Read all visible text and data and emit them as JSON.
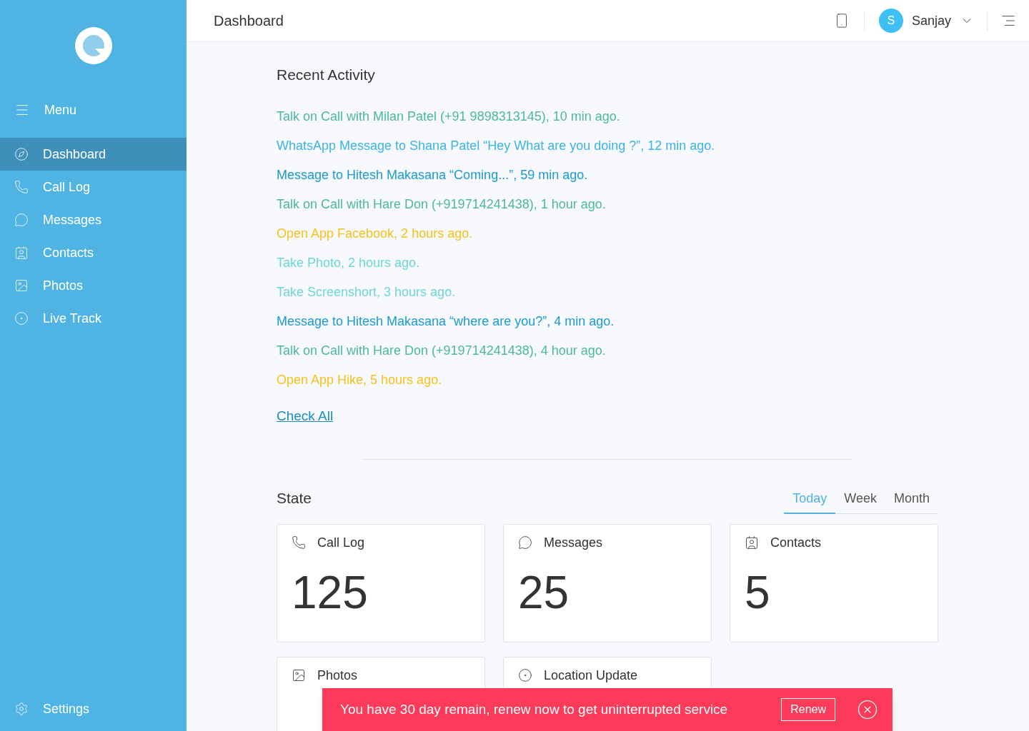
{
  "sidebar": {
    "menu_label": "Menu",
    "items": [
      {
        "label": "Dashboard",
        "selected": true
      },
      {
        "label": "Call Log",
        "selected": false
      },
      {
        "label": "Messages",
        "selected": false
      },
      {
        "label": "Contacts",
        "selected": false
      },
      {
        "label": "Photos",
        "selected": false
      },
      {
        "label": "Live Track",
        "selected": false
      }
    ],
    "settings_label": "Settings"
  },
  "header": {
    "title": "Dashboard",
    "user": {
      "initial": "S",
      "name": "Sanjay"
    }
  },
  "recent_activity": {
    "title": "Recent Activity",
    "items": [
      {
        "text": "Talk on Call with Milan Patel (+91 9898313145), 10 min ago.",
        "color": "#4cb8a0"
      },
      {
        "text": "WhatsApp Message to Shana Patel “Hey What are you doing ?”, 12 min ago.",
        "color": "#3bb3e6"
      },
      {
        "text": "Message to Hitesh Makasana “Coming...”, 59 min ago.",
        "color": "#1a9ad6"
      },
      {
        "text": "Talk on Call with Hare Don (+919714241438), 1 hour ago.",
        "color": "#4cb8a0"
      },
      {
        "text": "Open App Facebook, 2 hours ago.",
        "color": "#f5c21b"
      },
      {
        "text": "Take Photo, 2 hours ago.",
        "color": "#6fd6d8"
      },
      {
        "text": "Take Screenshort, 3 hours ago.",
        "color": "#6fd6d8"
      },
      {
        "text": "Message to Hitesh Makasana “where are you?”, 4 min ago.",
        "color": "#1a9ad6"
      },
      {
        "text": "Talk on Call with Hare Don (+919714241438), 4 hour ago.",
        "color": "#4cb8a0"
      },
      {
        "text": "Open App Hike, 5 hours ago.",
        "color": "#f5c21b"
      }
    ],
    "link": "Check All"
  },
  "state": {
    "title": "State",
    "tabs": [
      {
        "label": "Today",
        "selected": true
      },
      {
        "label": "Week",
        "selected": false
      },
      {
        "label": "Month",
        "selected": false
      }
    ],
    "cards": [
      {
        "label": "Call Log",
        "value": "125"
      },
      {
        "label": "Messages",
        "value": "25"
      },
      {
        "label": "Contacts",
        "value": "5"
      },
      {
        "label": "Photos"
      },
      {
        "label": "Location Update"
      }
    ]
  },
  "banner": {
    "text": "You have 30 day remain, renew now to get uninterrupted service",
    "button": "Renew"
  }
}
